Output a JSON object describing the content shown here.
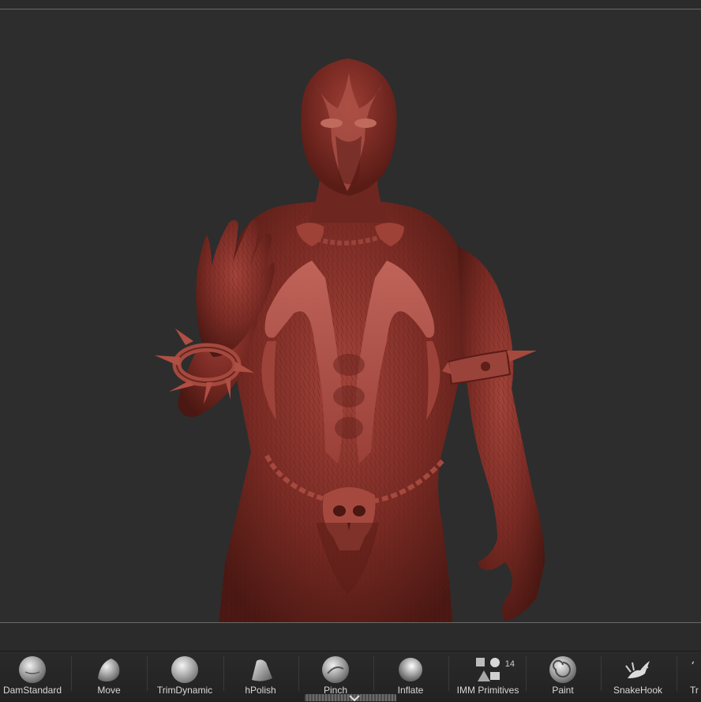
{
  "brush_shelf": {
    "brushes": [
      {
        "label": "DamStandard",
        "icon": "damstandard-brush-icon"
      },
      {
        "label": "Move",
        "icon": "move-brush-icon"
      },
      {
        "label": "TrimDynamic",
        "icon": "trimdynamic-brush-icon"
      },
      {
        "label": "hPolish",
        "icon": "hpolish-brush-icon"
      },
      {
        "label": "Pinch",
        "icon": "pinch-brush-icon"
      },
      {
        "label": "Inflate",
        "icon": "inflate-brush-icon"
      },
      {
        "label": "IMM Primitives",
        "icon": "imm-primitives-brush-icon",
        "count": "14"
      },
      {
        "label": "Paint",
        "icon": "paint-brush-icon"
      },
      {
        "label": "SnakeHook",
        "icon": "snakehook-brush-icon"
      },
      {
        "label": "Tr",
        "icon": "partial-brush-icon"
      }
    ]
  },
  "colors": {
    "background": "#2d2d2d",
    "model_base": "#7a2b24",
    "model_highlight": "#b4534a",
    "model_shadow": "#3e1410",
    "shelf_text": "#d8d8d8"
  }
}
